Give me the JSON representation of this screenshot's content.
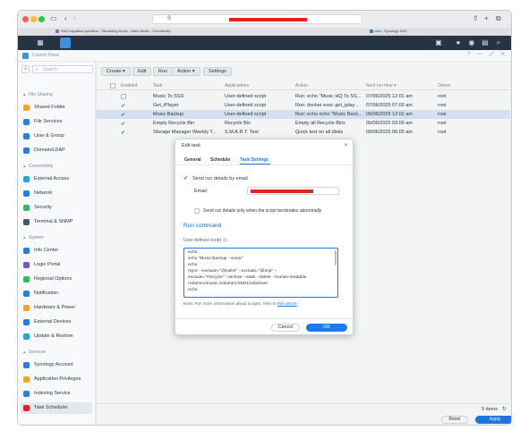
{
  "browser": {
    "address_text": "S",
    "tabs": [
      {
        "label": "SAS migration question - Streaming Audio - Naim Audio - Community"
      },
      {
        "label": "nas - Synology NAS"
      }
    ]
  },
  "window": {
    "title": "Control Panel",
    "controls": "? — ⤢ ✕"
  },
  "sidebar": {
    "search_placeholder": "Search",
    "home_icon": "⌂",
    "sections": [
      {
        "label": "File Sharing",
        "items": [
          {
            "label": "Shared Folder",
            "icon": "folder-icon",
            "color": "#f0a32e"
          },
          {
            "label": "File Services",
            "icon": "file-services-icon",
            "color": "#2f7cdb"
          },
          {
            "label": "User & Group",
            "icon": "user-group-icon",
            "color": "#2f7cdb"
          },
          {
            "label": "Domain/LDAP",
            "icon": "domain-icon",
            "color": "#2f7cdb"
          }
        ]
      },
      {
        "label": "Connectivity",
        "items": [
          {
            "label": "External Access",
            "icon": "globe-icon",
            "color": "#29a3d9"
          },
          {
            "label": "Network",
            "icon": "network-icon",
            "color": "#2f7cdb"
          },
          {
            "label": "Security",
            "icon": "shield-icon",
            "color": "#3ab56c"
          },
          {
            "label": "Terminal & SNMP",
            "icon": "terminal-icon",
            "color": "#4a5866"
          }
        ]
      },
      {
        "label": "System",
        "items": [
          {
            "label": "Info Center",
            "icon": "info-icon",
            "color": "#2f7cdb"
          },
          {
            "label": "Login Portal",
            "icon": "login-portal-icon",
            "color": "#7a58c9"
          },
          {
            "label": "Regional Options",
            "icon": "regional-icon",
            "color": "#3ab56c"
          },
          {
            "label": "Notification",
            "icon": "notification-icon",
            "color": "#2f7cdb"
          },
          {
            "label": "Hardware & Power",
            "icon": "power-icon",
            "color": "#f0a32e"
          },
          {
            "label": "External Devices",
            "icon": "external-device-icon",
            "color": "#2f7cdb"
          },
          {
            "label": "Update & Restore",
            "icon": "update-icon",
            "color": "#29a3d9"
          }
        ]
      },
      {
        "label": "Services",
        "items": [
          {
            "label": "Synology Account",
            "icon": "account-icon",
            "color": "#2f7cdb"
          },
          {
            "label": "Application Privileges",
            "icon": "privileges-icon",
            "color": "#f0a32e"
          },
          {
            "label": "Indexing Service",
            "icon": "indexing-icon",
            "color": "#2f7cdb"
          },
          {
            "label": "Task Scheduler",
            "icon": "calendar-icon",
            "color": "#e0231f",
            "active": true
          }
        ]
      }
    ]
  },
  "toolbar": {
    "create": "Create ▾",
    "edit": "Edit",
    "run": "Run",
    "action": "Action ▾",
    "settings": "Settings"
  },
  "table": {
    "headers": [
      "Enabled",
      "Task",
      "Applications",
      "Action",
      "Next run time ▾",
      "Owner"
    ],
    "rows": [
      {
        "enabled": false,
        "task": "Music To SSD",
        "app": "User-defined script",
        "action": "Run: echo \"Music HQ To SS...",
        "next": "07/06/2025 12:01 am",
        "owner": "root"
      },
      {
        "enabled": true,
        "task": "Get_iPlayer",
        "app": "User-defined script",
        "action": "Run: docker exec get_iplay...",
        "next": "07/06/2025 07:00 am",
        "owner": "root"
      },
      {
        "enabled": true,
        "task": "Music Backup",
        "app": "User-defined script",
        "action": "Run: echo echo \"Music Back...",
        "next": "09/06/2025 12:01 am",
        "owner": "root",
        "selected": true
      },
      {
        "enabled": true,
        "task": "Empty Recycle Bin",
        "app": "Recycle Bin",
        "action": "Empty all Recycle Bins",
        "next": "09/06/2025 03:00 am",
        "owner": "root"
      },
      {
        "enabled": true,
        "task": "Storage Manager Weekly T...",
        "app": "S.M.A.R.T. Test",
        "action": "Quick test on all disks",
        "next": "09/06/2025 06:00 am",
        "owner": "root"
      }
    ],
    "count": "5 items"
  },
  "footer": {
    "reset": "Reset",
    "apply": "Apply"
  },
  "modal": {
    "title": "Edit task",
    "tabs": [
      "General",
      "Schedule",
      "Task Settings"
    ],
    "active_tab": "Task Settings",
    "send_email_label": "Send run details by email",
    "email_label": "Email:",
    "only_abnormal_label": "Send run details only when the script terminates abnormally",
    "section_title": "Run command",
    "script_label": "User-defined script",
    "script_lines": [
      "echo",
      "echo \"Music Backup - music\"",
      "echo",
      "rsync --exclude=\"@eaDir\" --exclude=\"@tmp\" --",
      "exclude=\"#recycle\" --archive --stats --delete --human-readable",
      "/volume1/music /volume1/SSD1/usbshare",
      "echo"
    ],
    "note_key": "Note:",
    "note_text": " For more information about scripts, refer to ",
    "note_link": "this article",
    "note_end": ".",
    "cancel": "Cancel",
    "ok": "OK"
  },
  "colors": {
    "accent": "#1e7be5",
    "dsm_top": "#263342",
    "redaction": "#e0231f"
  }
}
